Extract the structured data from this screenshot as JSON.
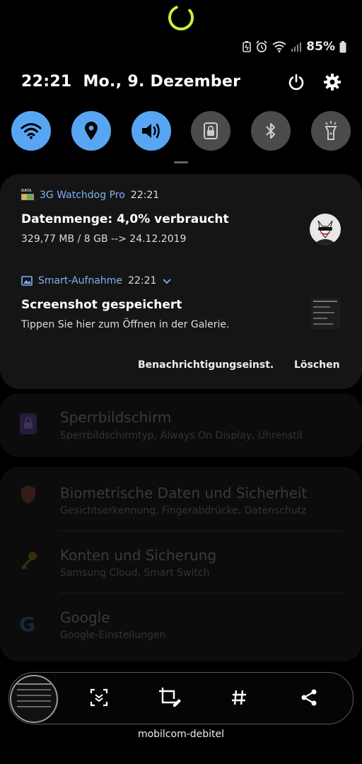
{
  "status": {
    "battery": "85%",
    "icons": [
      "battery-saver-icon",
      "alarm-icon",
      "wifi-icon",
      "signal-icon",
      "battery-icon"
    ]
  },
  "header": {
    "time": "22:21",
    "date": "Mo., 9. Dezember"
  },
  "quick_toggles": [
    {
      "name": "wifi",
      "state": "on"
    },
    {
      "name": "location",
      "state": "on"
    },
    {
      "name": "sound",
      "state": "on"
    },
    {
      "name": "secure-folder",
      "state": "off"
    },
    {
      "name": "bluetooth",
      "state": "off"
    },
    {
      "name": "flashlight",
      "state": "off"
    }
  ],
  "notifications": [
    {
      "app_name": "3G Watchdog Pro",
      "icon_label": "DATA",
      "time": "22:21",
      "title": "Datenmenge: 4,0% verbraucht",
      "text": "329,77 MB / 8 GB --> 24.12.2019"
    },
    {
      "app_name": "Smart-Aufnahme",
      "time": "22:21",
      "title": "Screenshot gespeichert",
      "text": "Tippen Sie hier zum Öffnen in der Galerie."
    }
  ],
  "actions": {
    "settings": "Benachrichtigungseinst.",
    "clear": "Löschen"
  },
  "settings_items": [
    {
      "title": "Sperrbildschirm",
      "subtitle": "Sperrbildschirmtyp, Always On Display, Uhrenstil"
    },
    {
      "title": "Biometrische Daten und Sicherheit",
      "subtitle": "Gesichtserkennung, Fingerabdrücke, Datenschutz"
    },
    {
      "title": "Konten und Sicherung",
      "subtitle": "Samsung Cloud, Smart Switch"
    },
    {
      "title": "Google",
      "subtitle": "Google-Einstellungen"
    }
  ],
  "colors": {
    "accent": "#58a6f3",
    "app_name": "#7fb2f2",
    "spinner": "#c8f03c"
  },
  "carrier": "mobilcom-debitel"
}
